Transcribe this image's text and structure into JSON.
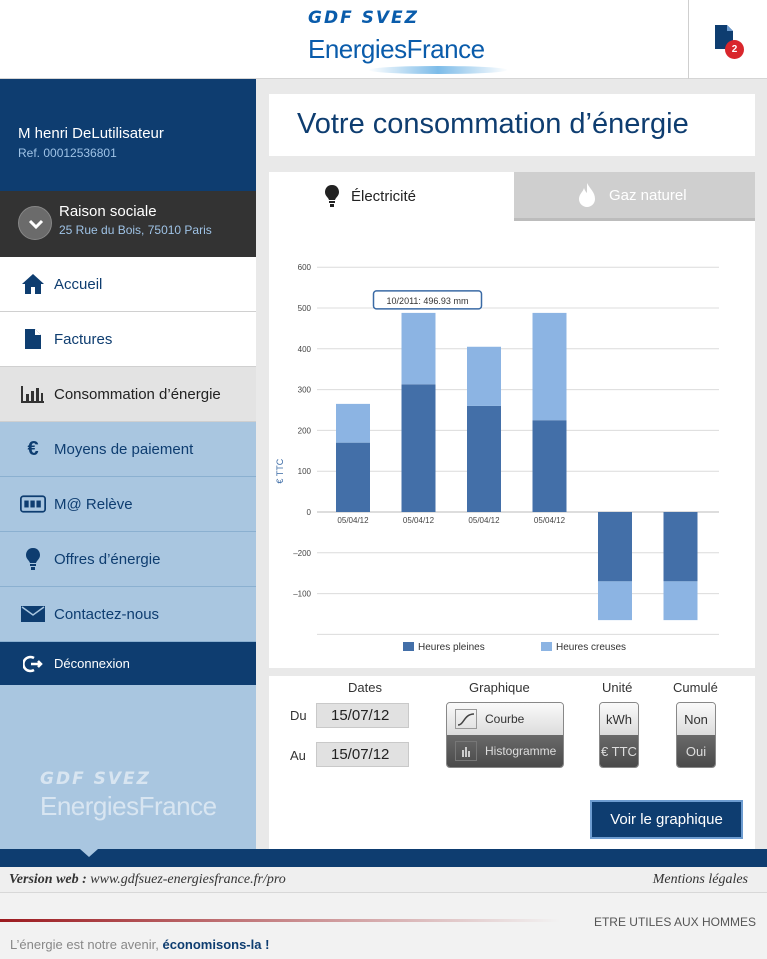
{
  "header": {
    "logo_line1": "GDF SVEZ",
    "logo_line2": "EnergiesFrance",
    "documents_badge_count": "2"
  },
  "sidebar": {
    "user_name": "M henri DeLutilisateur",
    "user_ref": "Ref. 00012536801",
    "company_name": "Raison sociale",
    "company_address": "25 Rue du Bois, 75010 Paris",
    "items": [
      {
        "label": "Accueil",
        "icon": "home-icon"
      },
      {
        "label": "Factures",
        "icon": "document-icon"
      },
      {
        "label": "Consommation d’énergie",
        "icon": "bar-chart-icon"
      },
      {
        "label": "Moyens de paiement",
        "icon": "euro-icon"
      },
      {
        "label": "M@ Relève",
        "icon": "meter-icon"
      },
      {
        "label": "Offres d’énergie",
        "icon": "lightbulb-icon"
      },
      {
        "label": "Contactez-nous",
        "icon": "envelope-icon"
      }
    ],
    "logout_label": "Déconnexion",
    "footer_logo_line1": "GDF SVEZ",
    "footer_logo_line2": "EnergiesFrance"
  },
  "main": {
    "title": "Votre consommation d’énergie",
    "tabs": [
      {
        "label": "Électricité",
        "active": true
      },
      {
        "label": "Gaz naturel",
        "active": false
      }
    ]
  },
  "chart_data": {
    "type": "bar",
    "stacked": true,
    "ylabel": "€ TTC",
    "ylim": [
      -300,
      600
    ],
    "yticks": [
      600,
      500,
      400,
      300,
      200,
      100,
      0,
      -200,
      -100
    ],
    "categories": [
      "05/04/12",
      "05/04/12",
      "05/04/12",
      "05/04/12",
      "",
      ""
    ],
    "series": [
      {
        "name": "Heures pleines",
        "color": "#436fa8",
        "values": [
          170,
          313,
          260,
          225,
          -170,
          -170
        ]
      },
      {
        "name": "Heures creuses",
        "color": "#8cb4e3",
        "values": [
          95,
          175,
          145,
          263,
          -95,
          -95
        ]
      }
    ],
    "tooltip": {
      "text": "10/2011: 496.93 mm",
      "category_index": 1
    },
    "legend_position": "bottom",
    "grid": true
  },
  "controls": {
    "dates_header": "Dates",
    "from_label": "Du",
    "from_value": "15/07/12",
    "to_label": "Au",
    "to_value": "15/07/12",
    "graph_header": "Graphique",
    "graph_options": [
      "Courbe",
      "Histogramme"
    ],
    "graph_selected": "Courbe",
    "unit_header": "Unité",
    "unit_options": [
      "kWh",
      "€ TTC"
    ],
    "cumul_header": "Cumulé",
    "cumul_options": [
      "Non",
      "Oui"
    ],
    "submit_label": "Voir le graphique"
  },
  "footer": {
    "version_prefix": "Version web :",
    "version_url": "www.gdfsuez-energiesfrance.fr/pro",
    "legal": "Mentions légales",
    "motto": "ETRE UTILES AUX HOMMES",
    "tagline_prefix": "L’énergie est notre avenir,",
    "tagline_bold": "économisons-la !"
  }
}
